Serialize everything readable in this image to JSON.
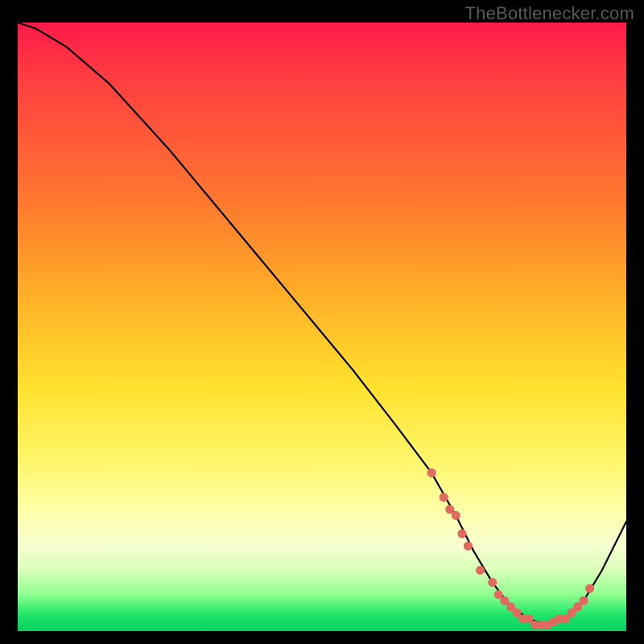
{
  "watermark": {
    "text": "TheBottlenecker.com"
  },
  "colors": {
    "gradient_top": "#ff1a4a",
    "gradient_mid": "#ffe22e",
    "gradient_bottom": "#00d060",
    "curve": "#000000",
    "dots": "#e2695f",
    "background": "#000000"
  },
  "chart_data": {
    "type": "line",
    "title": "",
    "xlabel": "",
    "ylabel": "",
    "xlim": [
      0,
      100
    ],
    "ylim": [
      0,
      100
    ],
    "grid": false,
    "legend": false,
    "x": [
      0,
      3,
      8,
      15,
      25,
      35,
      45,
      55,
      62,
      68,
      72,
      75,
      78,
      81,
      84,
      87,
      90,
      93,
      96,
      100
    ],
    "values": [
      100,
      99,
      96,
      90,
      79,
      67,
      55,
      43,
      34,
      26,
      19,
      13,
      8,
      4,
      2,
      1,
      2,
      5,
      10,
      18
    ],
    "series": [
      {
        "name": "bottleneck-curve",
        "x": [
          0,
          3,
          8,
          15,
          25,
          35,
          45,
          55,
          62,
          68,
          72,
          75,
          78,
          81,
          84,
          87,
          90,
          93,
          96,
          100
        ],
        "values": [
          100,
          99,
          96,
          90,
          79,
          67,
          55,
          43,
          34,
          26,
          19,
          13,
          8,
          4,
          2,
          1,
          2,
          5,
          10,
          18
        ]
      }
    ],
    "dots": [
      {
        "x": 68,
        "y": 26
      },
      {
        "x": 70,
        "y": 22
      },
      {
        "x": 71,
        "y": 20
      },
      {
        "x": 72,
        "y": 19
      },
      {
        "x": 73,
        "y": 16
      },
      {
        "x": 74,
        "y": 14
      },
      {
        "x": 76,
        "y": 10
      },
      {
        "x": 78,
        "y": 8
      },
      {
        "x": 79,
        "y": 6
      },
      {
        "x": 80,
        "y": 5
      },
      {
        "x": 81,
        "y": 4
      },
      {
        "x": 82,
        "y": 3
      },
      {
        "x": 83,
        "y": 2
      },
      {
        "x": 84,
        "y": 2
      },
      {
        "x": 85,
        "y": 1
      },
      {
        "x": 86,
        "y": 1
      },
      {
        "x": 87,
        "y": 1
      },
      {
        "x": 88,
        "y": 1.5
      },
      {
        "x": 89,
        "y": 2
      },
      {
        "x": 90,
        "y": 2
      },
      {
        "x": 91,
        "y": 3
      },
      {
        "x": 92,
        "y": 4
      },
      {
        "x": 93,
        "y": 5
      },
      {
        "x": 94,
        "y": 7
      }
    ]
  }
}
